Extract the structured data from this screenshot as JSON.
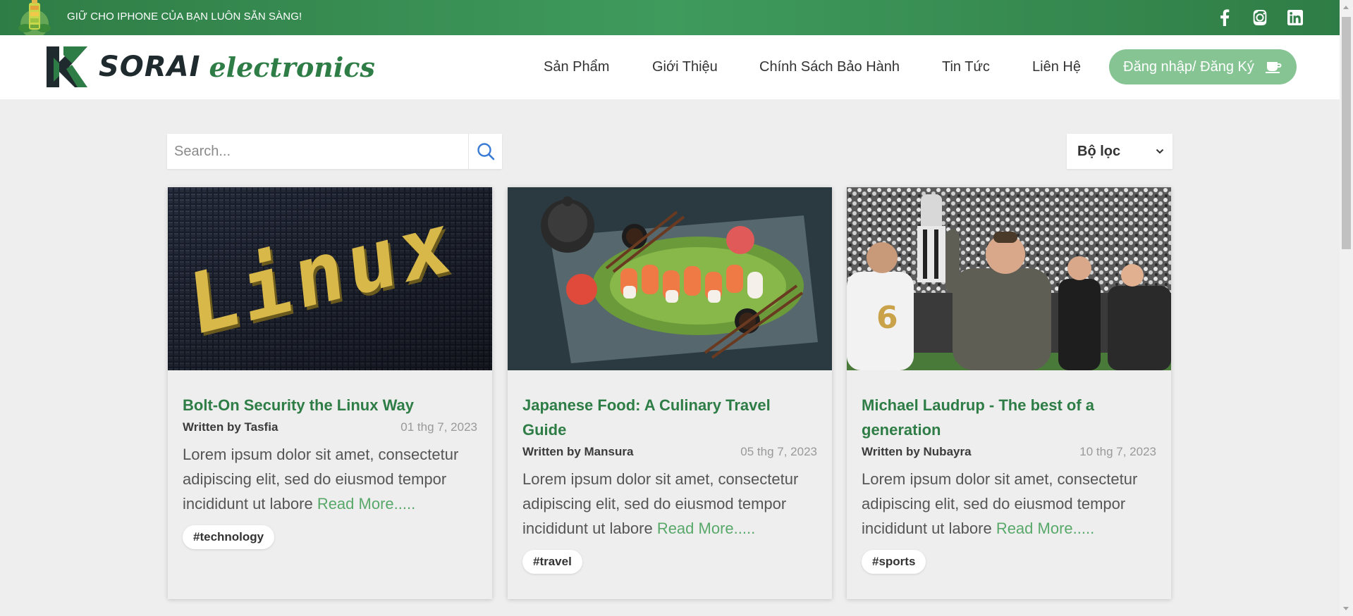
{
  "topbar": {
    "promo_text": "GIỮ CHO IPHONE CỦA BẠN LUÔN SẴN SÀNG!",
    "social": [
      "facebook-icon",
      "instagram-icon",
      "linkedin-icon"
    ]
  },
  "header": {
    "brand_word1": "SORAI",
    "brand_word2": "electronics",
    "nav": [
      "Sản Phẩm",
      "Giới Thiệu",
      "Chính Sách Bảo Hành",
      "Tin Tức",
      "Liên Hệ"
    ],
    "login_label": "Đăng nhập/ Đăng Ký"
  },
  "search": {
    "placeholder": "Search..."
  },
  "filter": {
    "label": "Bộ lọc"
  },
  "colors": {
    "brand_green": "#2f7d46",
    "button_green": "#86c494",
    "link_green": "#58a86a"
  },
  "posts": [
    {
      "title": "Bolt-On Security the Linux Way",
      "author": "Written by Tasfia",
      "date": "01 thg 7, 2023",
      "excerpt": "Lorem ipsum dolor sit amet, consectetur adipiscing elit, sed do eiusmod tempor incididunt ut labore",
      "read_more": "Read More.....",
      "tag": "#technology",
      "image": "linux-image",
      "image_text": "Linux"
    },
    {
      "title": "Japanese Food: A Culinary Travel Guide",
      "author": "Written by Mansura",
      "date": "05 thg 7, 2023",
      "excerpt": "Lorem ipsum dolor sit amet, consectetur adipiscing elit, sed do eiusmod tempor incididunt ut labore",
      "read_more": "Read More.....",
      "tag": "#travel",
      "image": "sushi-image"
    },
    {
      "title": "Michael Laudrup - The best of a generation",
      "author": "Written by Nubayra",
      "date": "10 thg 7, 2023",
      "excerpt": "Lorem ipsum dolor sit amet, consectetur adipiscing elit, sed do eiusmod tempor incididunt ut labore",
      "read_more": "Read More.....",
      "tag": "#sports",
      "image": "trophy-image"
    }
  ]
}
